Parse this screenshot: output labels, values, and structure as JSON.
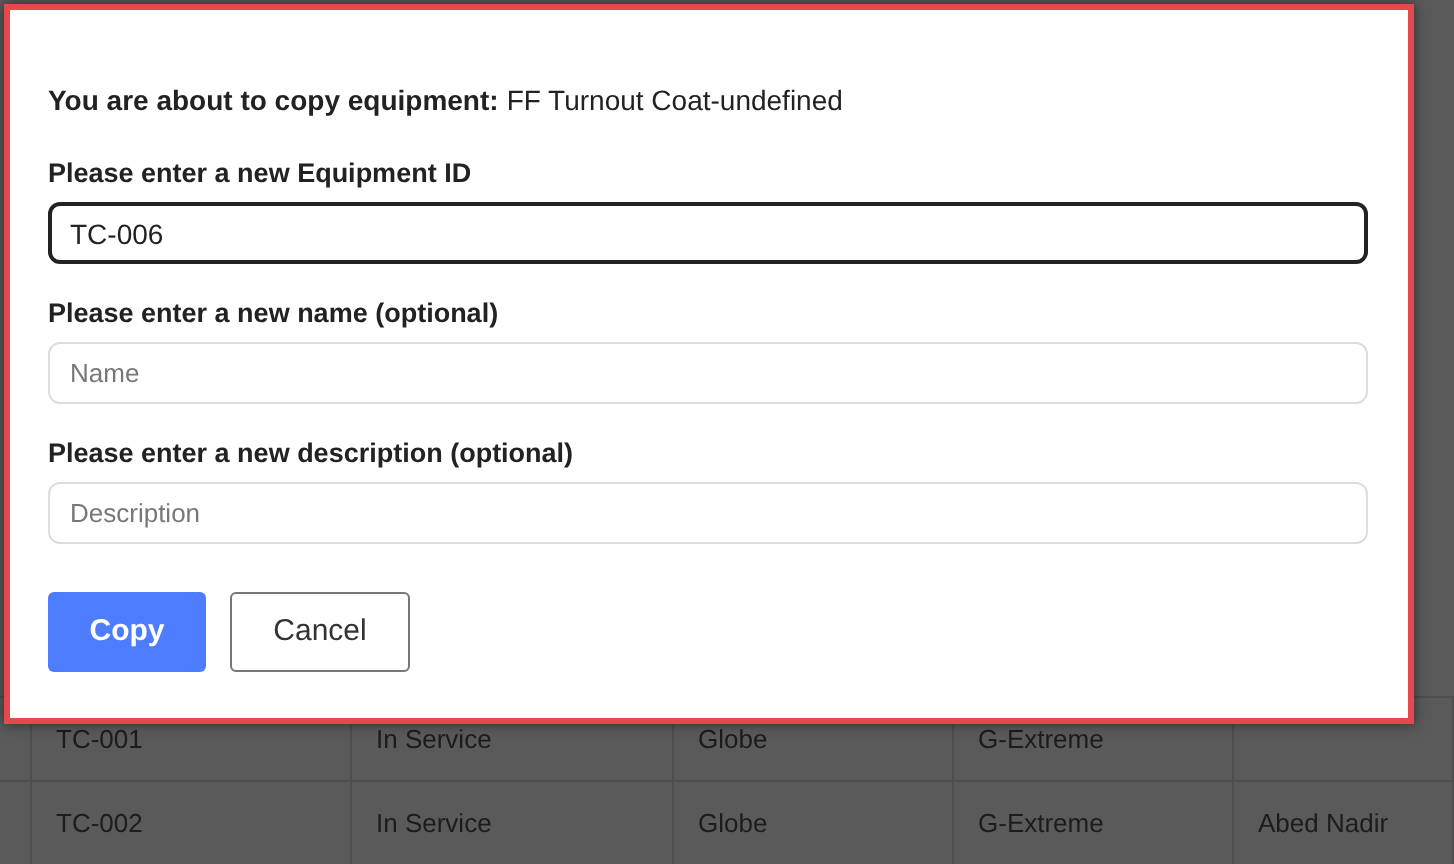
{
  "dialog": {
    "intro_label": "You are about to copy equipment:",
    "intro_value": "FF Turnout Coat-undefined",
    "fields": [
      {
        "label": "Please enter a new Equipment ID",
        "value": "TC-006",
        "focused": true
      },
      {
        "label": "Please enter a new name (optional)",
        "placeholder": "Name",
        "focused": false
      },
      {
        "label": "Please enter a new description (optional)",
        "placeholder": "Description",
        "focused": false
      }
    ],
    "buttons": [
      {
        "label": "Copy",
        "kind": "primary"
      },
      {
        "label": "Cancel",
        "kind": "secondary"
      }
    ]
  },
  "table": {
    "rows": [
      {
        "cells": [
          "TC-001",
          "In Service",
          "Globe",
          "G-Extreme",
          ""
        ]
      },
      {
        "cells": [
          "TC-002",
          "In Service",
          "Globe",
          "G-Extreme",
          "Abed Nadir"
        ]
      }
    ]
  }
}
